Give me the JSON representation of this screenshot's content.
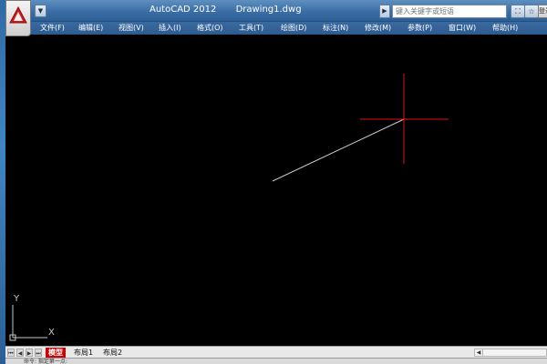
{
  "title_bar": {
    "app_name": "AutoCAD 2012",
    "document": "Drawing1.dwg",
    "search_placeholder": "键入关键字或短语",
    "icons": [
      "binoculars-icon",
      "star-icon"
    ],
    "login_label": "登录"
  },
  "menu": {
    "items": [
      {
        "label": "文件(F)"
      },
      {
        "label": "编辑(E)"
      },
      {
        "label": "视图(V)"
      },
      {
        "label": "插入(I)"
      },
      {
        "label": "格式(O)"
      },
      {
        "label": "工具(T)"
      },
      {
        "label": "绘图(D)"
      },
      {
        "label": "标注(N)"
      },
      {
        "label": "修改(M)"
      },
      {
        "label": "参数(P)"
      },
      {
        "label": "窗口(W)"
      },
      {
        "label": "帮助(H)"
      }
    ]
  },
  "drawing": {
    "background": "#000000",
    "crosshair_color": "#e01414",
    "line_color": "#c8c8c8",
    "ucs": {
      "x_label": "X",
      "y_label": "Y"
    }
  },
  "layout_tabs": {
    "tabs": [
      {
        "label": "模型",
        "active": true
      },
      {
        "label": "布局1",
        "active": false
      },
      {
        "label": "布局2",
        "active": false
      }
    ]
  },
  "command_line": {
    "text": "命令: 指定第一点:"
  }
}
